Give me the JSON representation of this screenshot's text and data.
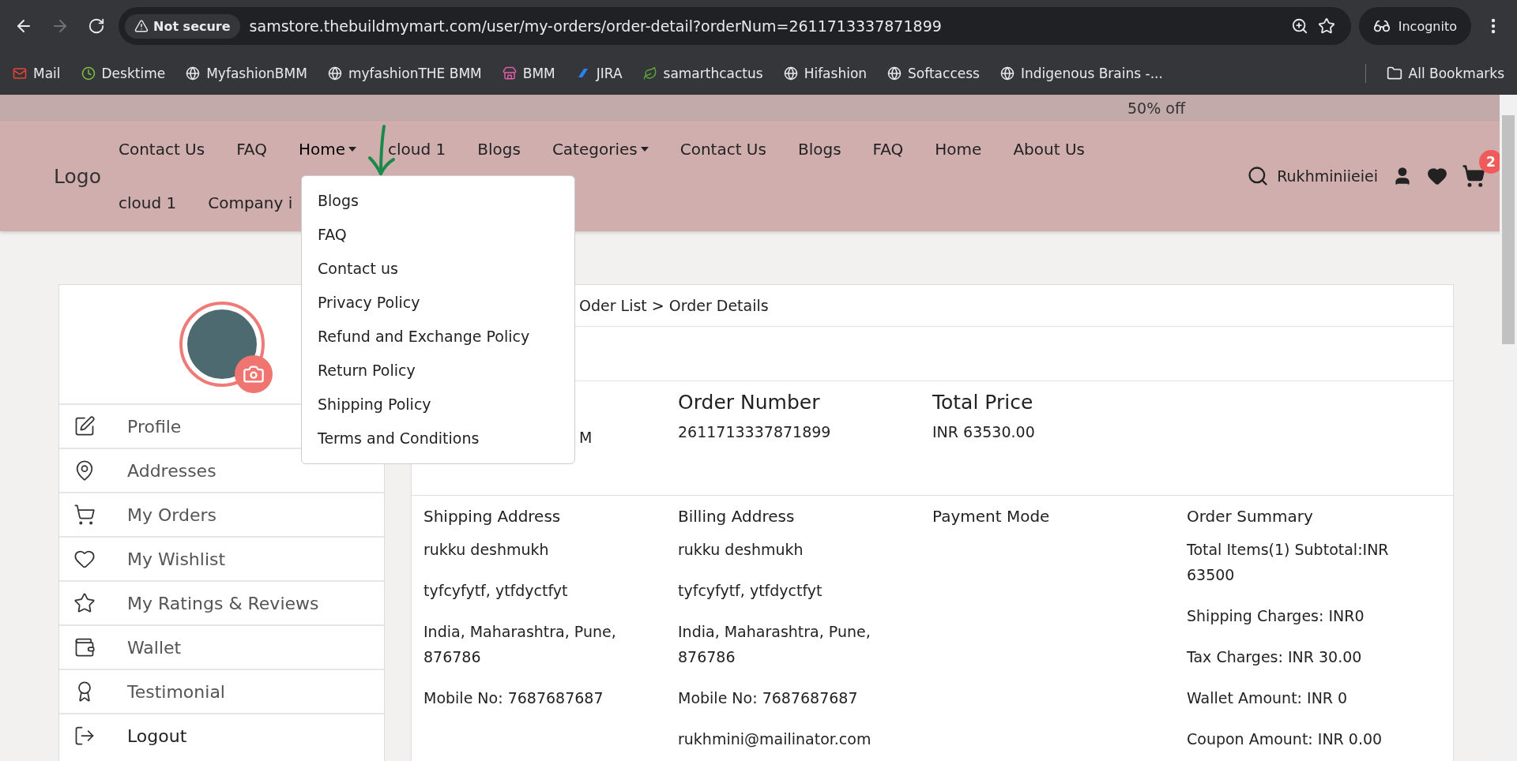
{
  "browser": {
    "security_label": "Not secure",
    "url": "samstore.thebuildmymart.com/user/my-orders/order-detail?orderNum=2611713337871899",
    "profile_label": "Incognito"
  },
  "bookmarks": [
    "Mail",
    "Desktime",
    "MyfashionBMM",
    "myfashionTHE BMM",
    "BMM",
    "JIRA",
    "samarthcactus",
    "Hifashion",
    "Softaccess",
    "Indigenous Brains -..."
  ],
  "all_bookmarks": "All Bookmarks",
  "promo": "50% off",
  "nav": {
    "logo": "Logo",
    "row_1": [
      {
        "label": "Contact Us",
        "dropdown": false
      },
      {
        "label": "FAQ",
        "dropdown": false
      },
      {
        "label": "Home",
        "dropdown": true,
        "open": true
      },
      {
        "label": "cloud 1",
        "dropdown": false
      },
      {
        "label": "Blogs",
        "dropdown": false
      },
      {
        "label": "Categories",
        "dropdown": true,
        "open": false
      },
      {
        "label": "Contact Us",
        "dropdown": false
      },
      {
        "label": "Blogs",
        "dropdown": false
      },
      {
        "label": "FAQ",
        "dropdown": false
      },
      {
        "label": "Home",
        "dropdown": false
      },
      {
        "label": "About Us",
        "dropdown": false
      }
    ],
    "row_2": [
      {
        "label": "cloud 1"
      },
      {
        "label": "Company i"
      }
    ],
    "user_name": "Rukhminiieiei",
    "cart_count": "2"
  },
  "dropdown_menu": [
    "Blogs",
    "FAQ",
    "Contact us",
    "Privacy Policy",
    "Refund and Exchange Policy",
    "Return Policy",
    "Shipping Policy",
    "Terms and Conditions"
  ],
  "sidebar": {
    "items": [
      "Profile",
      "Addresses",
      "My Orders",
      "My Wishlist",
      "My Ratings & Reviews",
      "Wallet",
      "Testimonial",
      "Logout"
    ]
  },
  "breadcrumb": "Oder List > Order Details",
  "order_info": {
    "column_1_value": "M",
    "columns": [
      {
        "heading": "Order Number",
        "value": "2611713337871899"
      },
      {
        "heading": "Total Price",
        "value": "INR 63530.00"
      }
    ]
  },
  "details": [
    {
      "heading": "Shipping Address",
      "lines": [
        "rukku deshmukh",
        "tyfcyfytf, ytfdyctfyt",
        "India, Maharashtra, Pune, 876786",
        "Mobile No: 7687687687"
      ]
    },
    {
      "heading": "Billing Address",
      "lines": [
        "rukku deshmukh",
        "tyfcyfytf, ytfdyctfyt",
        "India, Maharashtra, Pune, 876786",
        "Mobile No: 7687687687",
        "rukhmini@mailinator.com"
      ]
    },
    {
      "heading": "Payment Mode"
    },
    {
      "heading": "Order Summary",
      "lines": [
        "Total Items(1) Subtotal:INR 63500",
        "Shipping Charges: INR0",
        "Tax Charges: INR 30.00",
        "Wallet Amount: INR 0",
        "Coupon Amount: INR 0.00"
      ]
    }
  ]
}
